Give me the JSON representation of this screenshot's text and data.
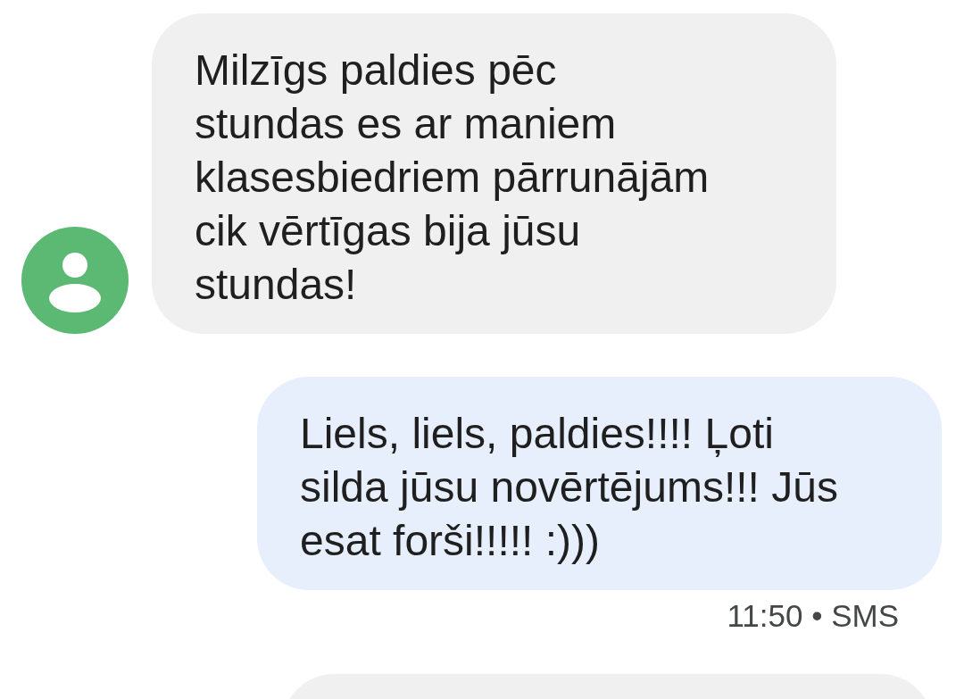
{
  "messages": [
    {
      "kind": "incoming",
      "text": "Milzīgs paldies pēc stundas es ar maniem klasesbiedriem pārrunājām cik vērtīgas bija jūsu stundas!"
    },
    {
      "kind": "outgoing",
      "text": "Liels, liels, paldies!!!! Ļoti silda jūsu novērtējums!!! Jūs esat forši!!!!! :)))",
      "meta": "11:50 • SMS"
    },
    {
      "kind": "partial"
    }
  ]
}
